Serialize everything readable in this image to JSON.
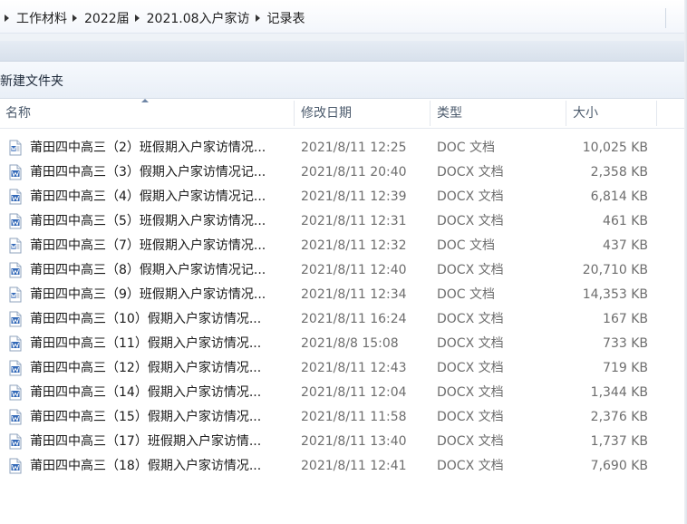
{
  "breadcrumb": {
    "items": [
      "工作材料",
      "2022届",
      "2021.08入户家访",
      "记录表"
    ]
  },
  "toolbar": {
    "new_folder_label": "新建文件夹"
  },
  "columns": {
    "name": "名称",
    "date_modified": "修改日期",
    "type": "类型",
    "size": "大小"
  },
  "colors": {
    "doc_icon": "#2f66b6",
    "secondary_text": "#6d6d6d"
  },
  "files": [
    {
      "name": "莆田四中高三（2）班假期入户家访情况...",
      "date": "2021/8/11 12:25",
      "type": "DOC 文档",
      "size": "10,025 KB",
      "icon": "word-doc-icon"
    },
    {
      "name": "莆田四中高三（3）假期入户家访情况记...",
      "date": "2021/8/11 20:40",
      "type": "DOCX 文档",
      "size": "2,358 KB",
      "icon": "word-docx-icon"
    },
    {
      "name": "莆田四中高三（4）假期入户家访情况记...",
      "date": "2021/8/11 12:39",
      "type": "DOCX 文档",
      "size": "6,814 KB",
      "icon": "word-docx-icon"
    },
    {
      "name": "莆田四中高三（5）班假期入户家访情况...",
      "date": "2021/8/11 12:31",
      "type": "DOCX 文档",
      "size": "461 KB",
      "icon": "word-docx-icon"
    },
    {
      "name": "莆田四中高三（7）班假期入户家访情况...",
      "date": "2021/8/11 12:32",
      "type": "DOC 文档",
      "size": "437 KB",
      "icon": "word-doc-icon"
    },
    {
      "name": "莆田四中高三（8）假期入户家访情况记...",
      "date": "2021/8/11 12:40",
      "type": "DOCX 文档",
      "size": "20,710 KB",
      "icon": "word-docx-icon"
    },
    {
      "name": "莆田四中高三（9）班假期入户家访情况...",
      "date": "2021/8/11 12:34",
      "type": "DOC 文档",
      "size": "14,353 KB",
      "icon": "word-doc-icon"
    },
    {
      "name": "莆田四中高三（10）假期入户家访情况...",
      "date": "2021/8/11 16:24",
      "type": "DOCX 文档",
      "size": "167 KB",
      "icon": "word-docx-icon"
    },
    {
      "name": "莆田四中高三（11）假期入户家访情况...",
      "date": "2021/8/8 15:08",
      "type": "DOCX 文档",
      "size": "733 KB",
      "icon": "word-docx-icon"
    },
    {
      "name": "莆田四中高三（12）假期入户家访情况...",
      "date": "2021/8/11 12:43",
      "type": "DOCX 文档",
      "size": "719 KB",
      "icon": "word-docx-icon"
    },
    {
      "name": "莆田四中高三（14）假期入户家访情况...",
      "date": "2021/8/11 12:04",
      "type": "DOCX 文档",
      "size": "1,344 KB",
      "icon": "word-docx-icon"
    },
    {
      "name": "莆田四中高三（15）假期入户家访情况...",
      "date": "2021/8/11 11:58",
      "type": "DOCX 文档",
      "size": "2,376 KB",
      "icon": "word-docx-icon"
    },
    {
      "name": "莆田四中高三（17）班假期入户家访情...",
      "date": "2021/8/11 13:40",
      "type": "DOCX 文档",
      "size": "1,737 KB",
      "icon": "word-docx-icon"
    },
    {
      "name": "莆田四中高三（18）假期入户家访情况...",
      "date": "2021/8/11 12:41",
      "type": "DOCX 文档",
      "size": "7,690 KB",
      "icon": "word-docx-icon"
    }
  ]
}
